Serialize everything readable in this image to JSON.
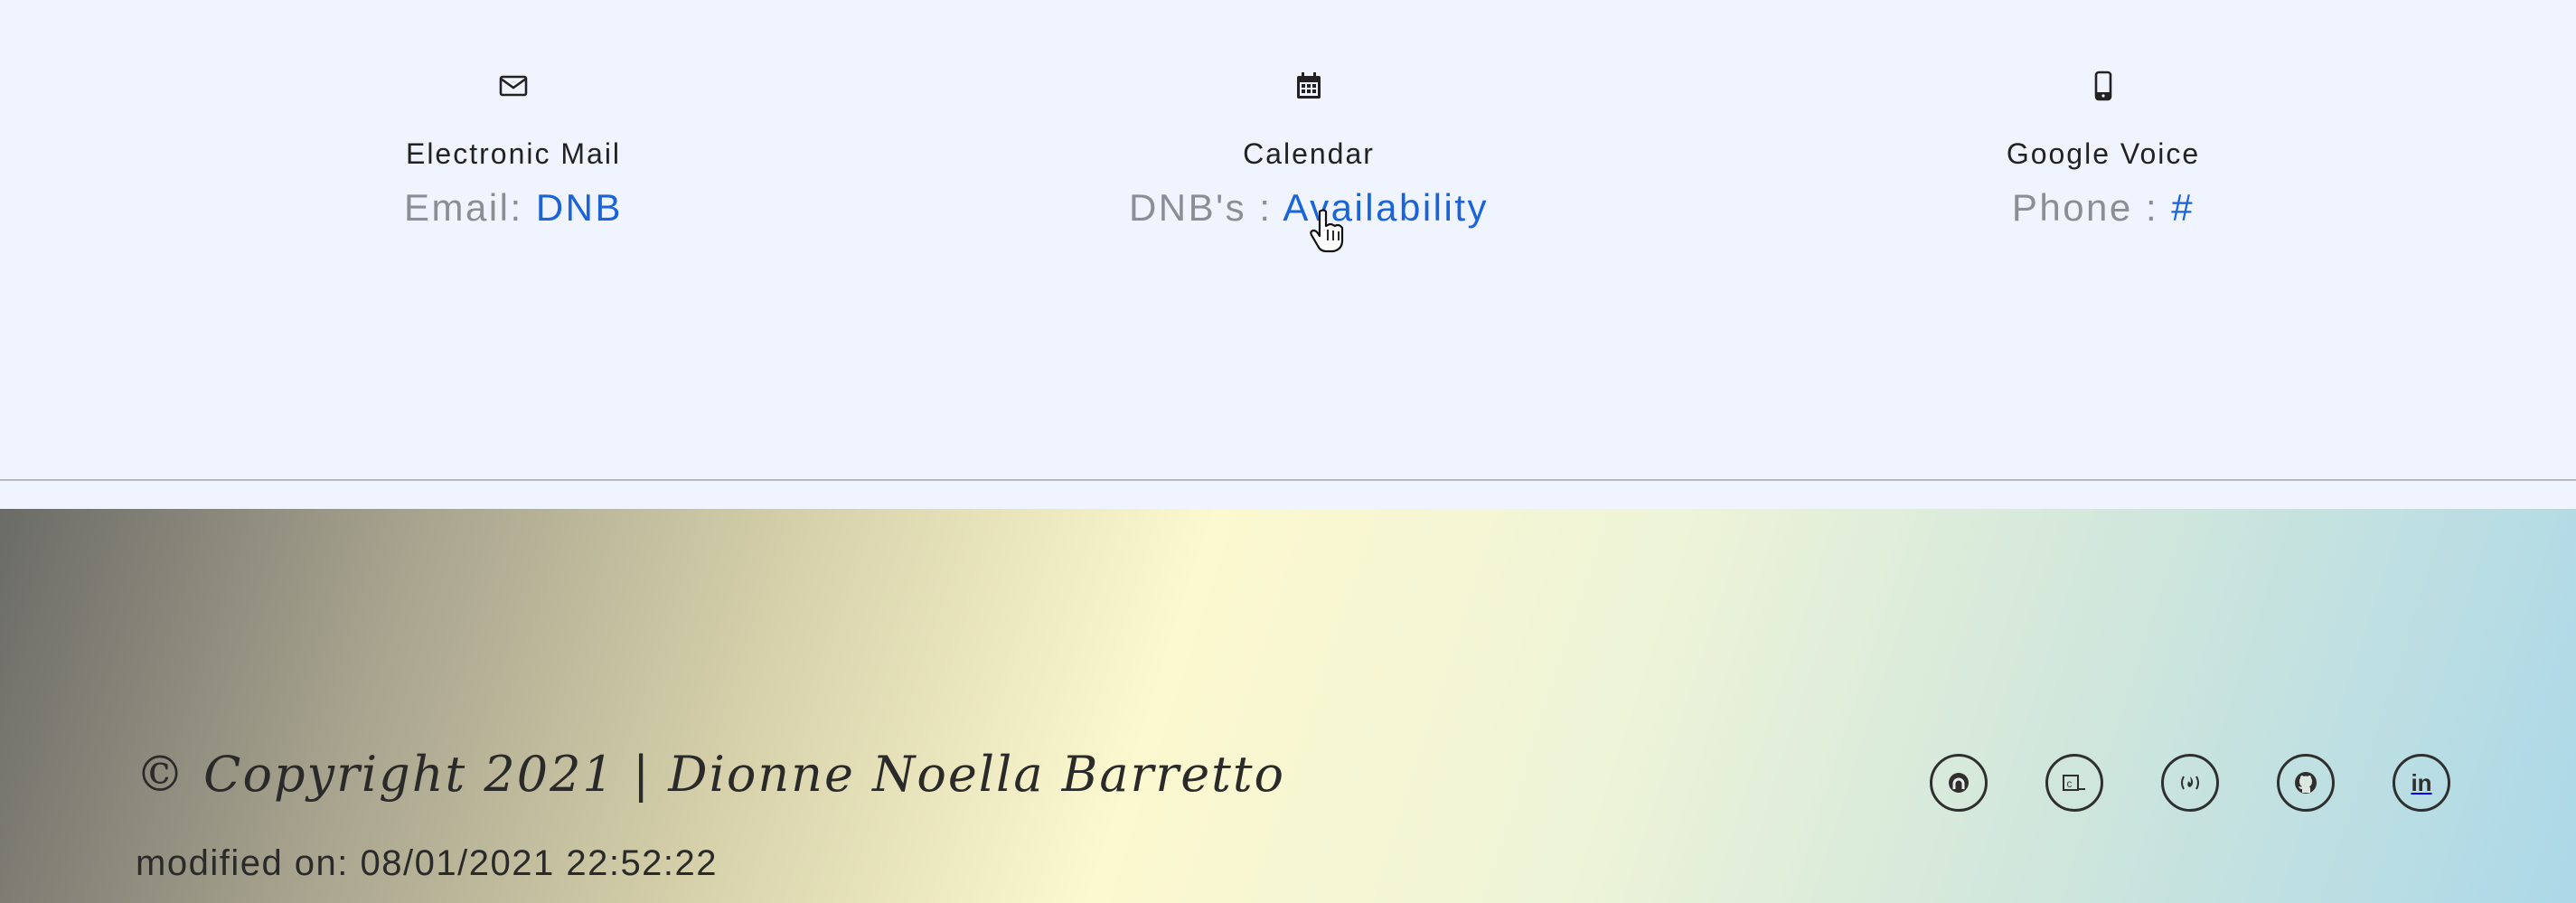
{
  "contacts": [
    {
      "icon": "envelope-icon",
      "heading": "Electronic Mail",
      "prefix": "Email: ",
      "link": "DNB"
    },
    {
      "icon": "calendar-icon",
      "heading": "Calendar",
      "prefix": "DNB's : ",
      "link": "Availability"
    },
    {
      "icon": "mobile-phone-icon",
      "heading": "Google Voice",
      "prefix": "Phone : ",
      "link": "#"
    }
  ],
  "footer": {
    "copyright": "© Copyright 2021 | Dionne Noella Barretto",
    "modified": "modified on: 08/01/2021 22:52:22",
    "social": [
      {
        "icon": "codepen-icon"
      },
      {
        "icon": "terminal-icon",
        "text": ""
      },
      {
        "icon": "freecodecamp-icon"
      },
      {
        "icon": "github-icon"
      },
      {
        "icon": "linkedin-icon",
        "text": "in"
      }
    ]
  },
  "colors": {
    "link": "#1a63d8",
    "muted": "#8a8f96",
    "background": "#eff4ff"
  }
}
